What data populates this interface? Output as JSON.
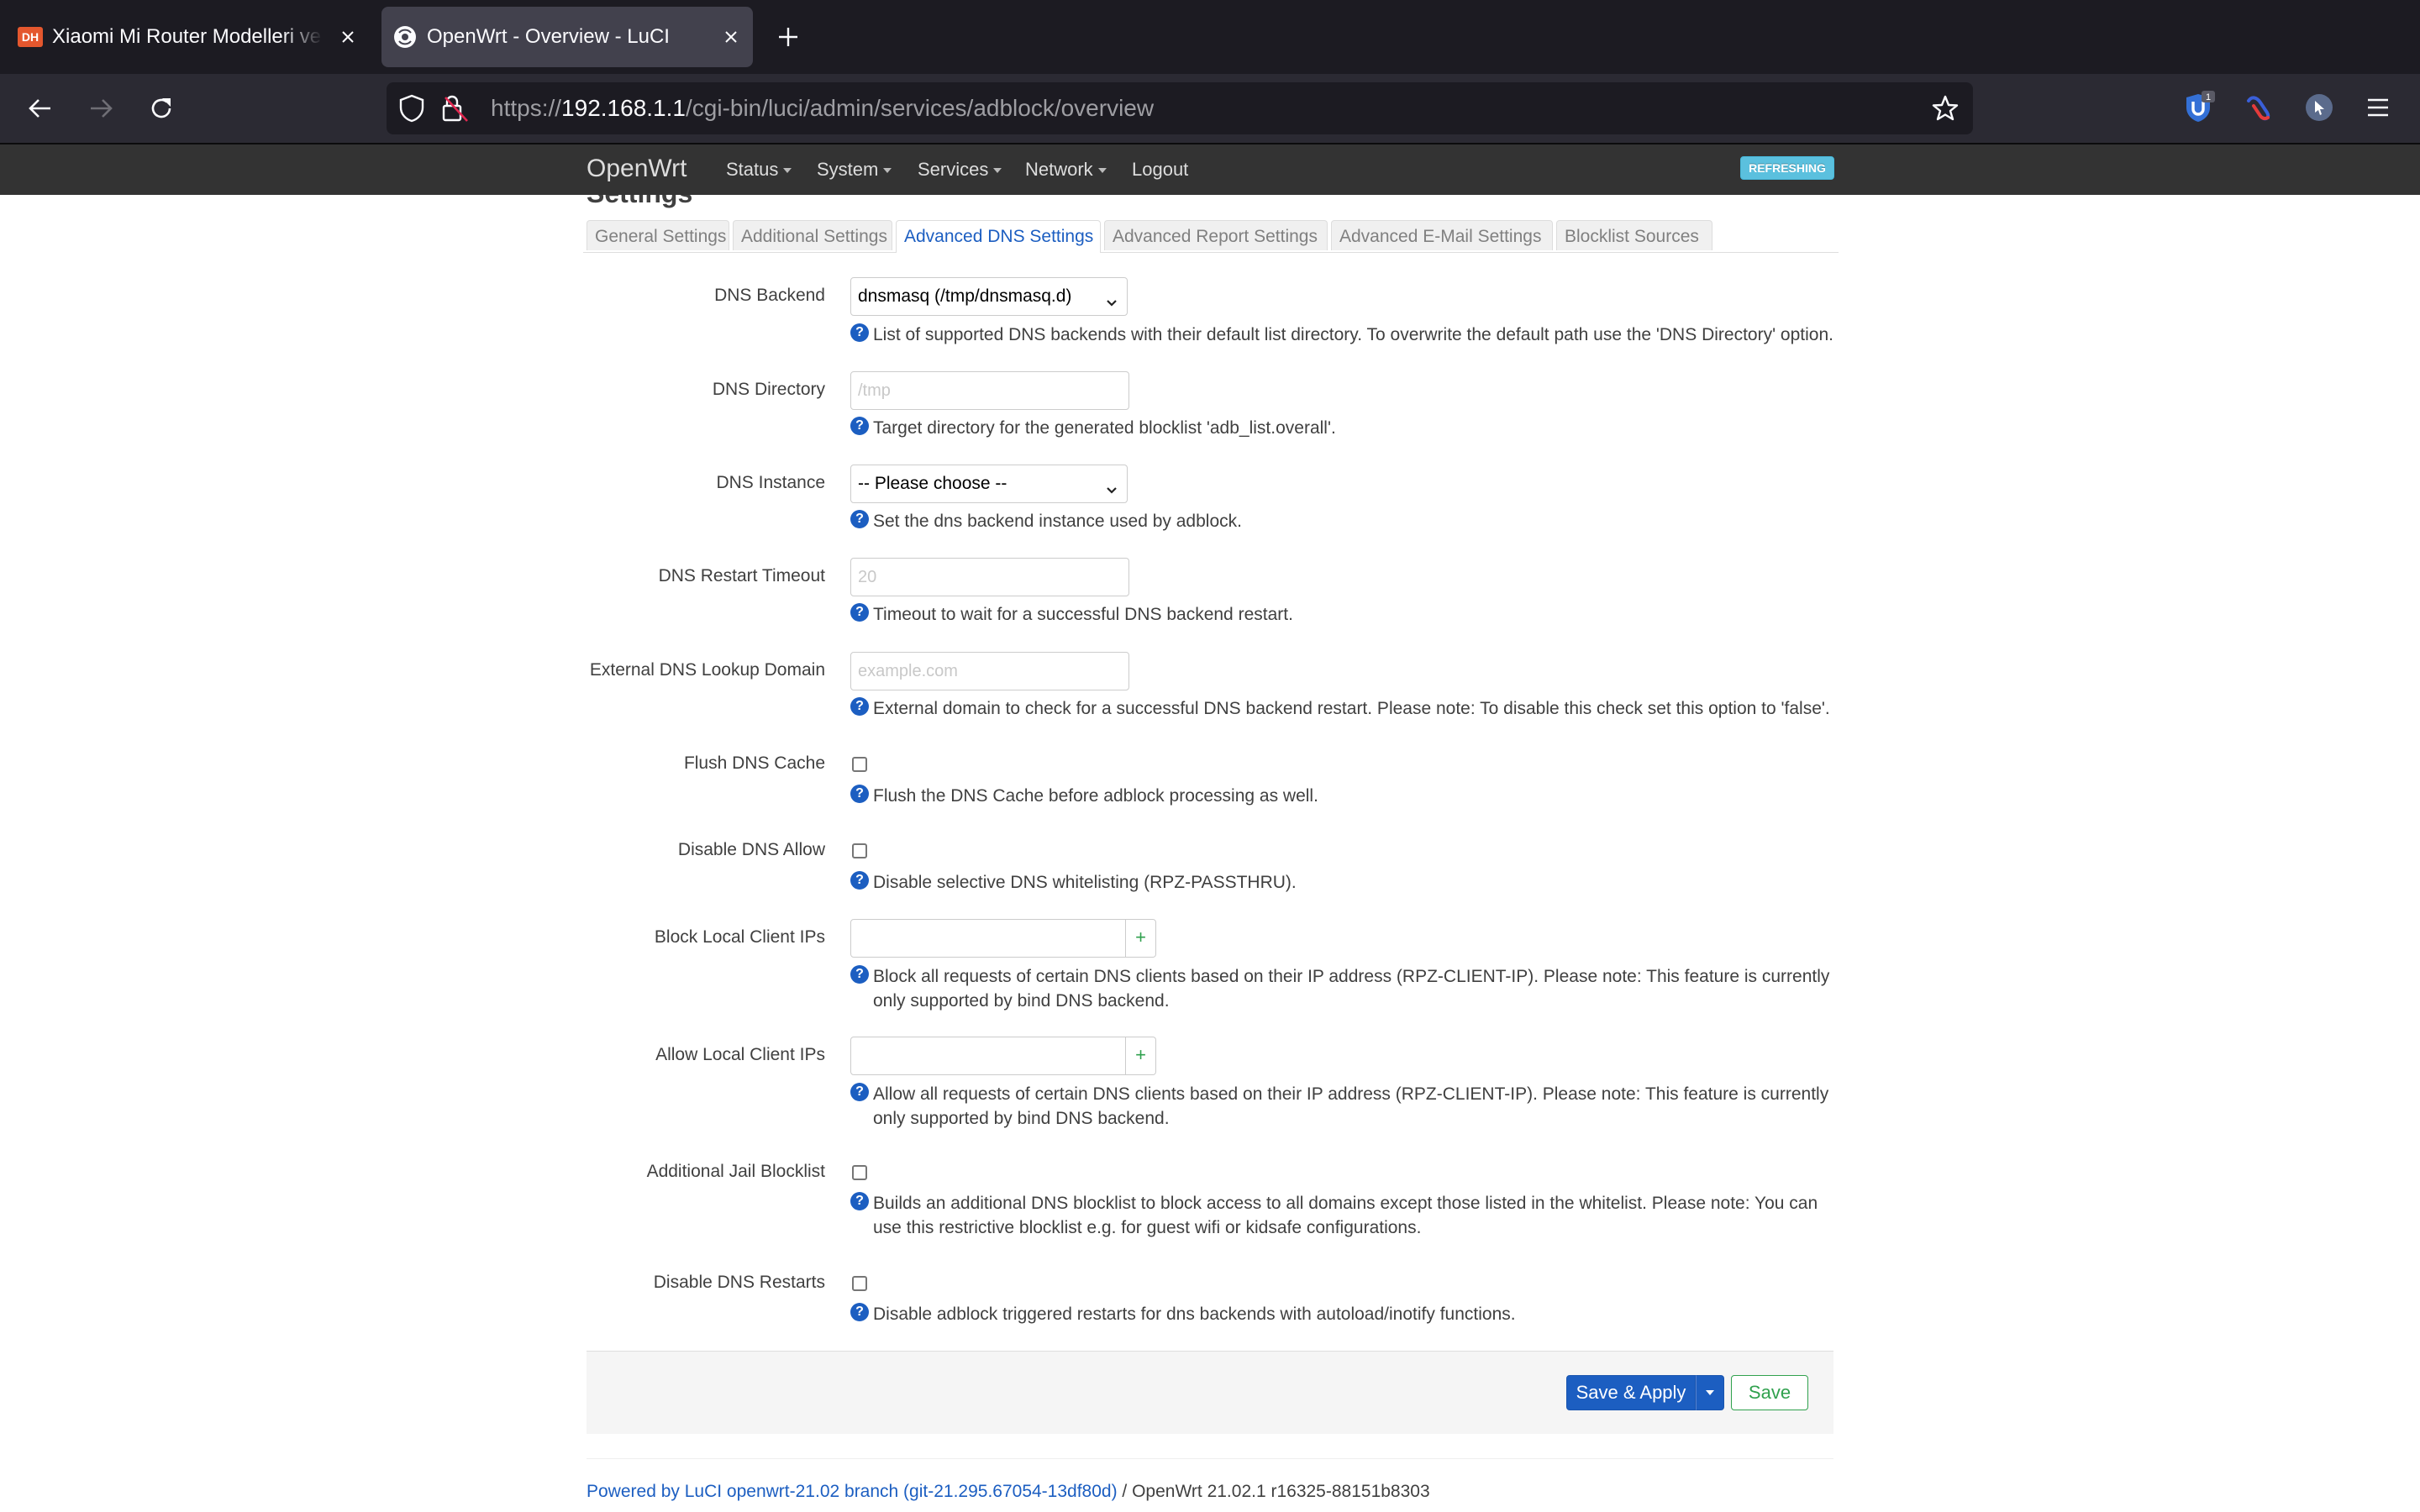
{
  "browser": {
    "tabs": [
      {
        "title": "Xiaomi Mi Router Modelleri ve OpenWrt",
        "favicon_text": "DH",
        "active": false
      },
      {
        "title": "OpenWrt - Overview - LuCI",
        "active": true
      }
    ],
    "url_scheme": "https://",
    "url_host": "192.168.1.1",
    "url_path": "/cgi-bin/luci/admin/services/adblock/overview",
    "extension_badge": "1"
  },
  "luci": {
    "brand": "OpenWrt",
    "menu": [
      "Status",
      "System",
      "Services",
      "Network"
    ],
    "logout": "Logout",
    "indicator": "REFRESHING"
  },
  "page": {
    "section_title": "Settings",
    "tabs": [
      "General Settings",
      "Additional Settings",
      "Advanced DNS Settings",
      "Advanced Report Settings",
      "Advanced E-Mail Settings",
      "Blocklist Sources"
    ],
    "active_tab": "Advanced DNS Settings"
  },
  "form": {
    "dns_backend": {
      "label": "DNS Backend",
      "value": "dnsmasq (/tmp/dnsmasq.d)",
      "help": "List of supported DNS backends with their default list directory. To overwrite the default path use the 'DNS Directory' option."
    },
    "dns_directory": {
      "label": "DNS Directory",
      "placeholder": "/tmp",
      "help": "Target directory for the generated blocklist 'adb_list.overall'."
    },
    "dns_instance": {
      "label": "DNS Instance",
      "value": "-- Please choose --",
      "help": "Set the dns backend instance used by adblock."
    },
    "dns_restart_timeout": {
      "label": "DNS Restart Timeout",
      "placeholder": "20",
      "help": "Timeout to wait for a successful DNS backend restart."
    },
    "external_dns_lookup": {
      "label": "External DNS Lookup Domain",
      "placeholder": "example.com",
      "help": "External domain to check for a successful DNS backend restart. Please note: To disable this check set this option to 'false'."
    },
    "flush_dns_cache": {
      "label": "Flush DNS Cache",
      "checked": false,
      "help": "Flush the DNS Cache before adblock processing as well."
    },
    "disable_dns_allow": {
      "label": "Disable DNS Allow",
      "checked": false,
      "help": "Disable selective DNS whitelisting (RPZ-PASSTHRU)."
    },
    "block_local_client_ips": {
      "label": "Block Local Client IPs",
      "add_symbol": "+",
      "help": "Block all requests of certain DNS clients based on their IP address (RPZ-CLIENT-IP). Please note: This feature is currently only supported by bind DNS backend."
    },
    "allow_local_client_ips": {
      "label": "Allow Local Client IPs",
      "add_symbol": "+",
      "help": "Allow all requests of certain DNS clients based on their IP address (RPZ-CLIENT-IP). Please note: This feature is currently only supported by bind DNS backend."
    },
    "additional_jail_blocklist": {
      "label": "Additional Jail Blocklist",
      "checked": false,
      "help": "Builds an additional DNS blocklist to block access to all domains except those listed in the whitelist. Please note: You can use this restrictive blocklist e.g. for guest wifi or kidsafe configurations."
    },
    "disable_dns_restarts": {
      "label": "Disable DNS Restarts",
      "checked": false,
      "help": "Disable adblock triggered restarts for dns backends with autoload/inotify functions."
    },
    "help_symbol": "?"
  },
  "actions": {
    "save_apply": "Save & Apply",
    "save": "Save"
  },
  "footer": {
    "link_text": "Powered by LuCI openwrt-21.02 branch (git-21.295.67054-13df80d)",
    "version_text": " / OpenWrt 21.02.1 r16325-88151b8303"
  },
  "colors": {
    "brand_blue": "#1c5ec1",
    "save_green": "#30a14e",
    "header_bg": "#333333",
    "refreshing_bg": "#5bc0de"
  }
}
